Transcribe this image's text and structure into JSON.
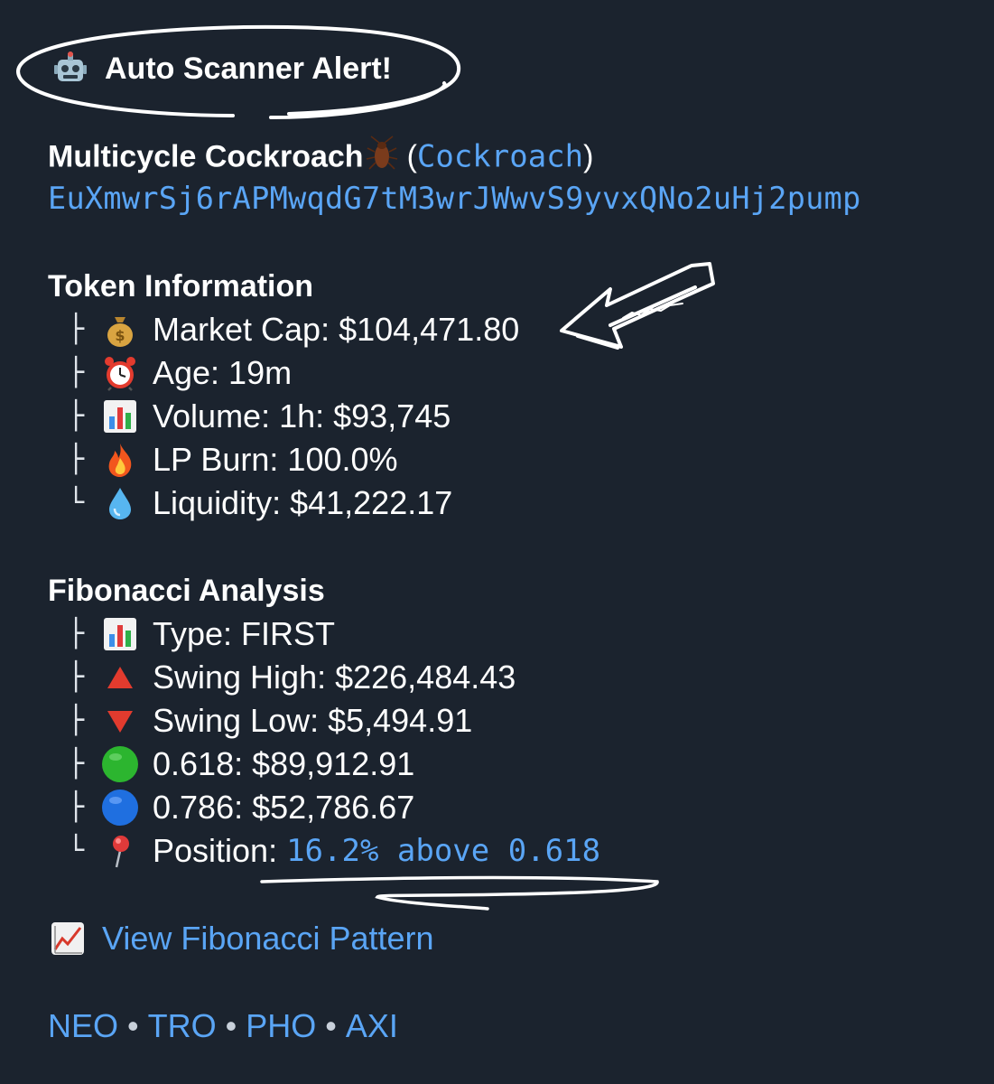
{
  "alert": {
    "title": "Auto Scanner Alert!",
    "icon": "robot-icon"
  },
  "token": {
    "name": "Multicycle Cockroach",
    "name_icon": "cockroach-icon",
    "paren_open": "(",
    "ticker": "Cockroach",
    "paren_close": ")",
    "address": "EuXmwrSj6rAPMwqdG7tM3wrJWwvS9yvxQNo2uHj2pump"
  },
  "token_info": {
    "heading": "Token Information",
    "items": [
      {
        "branch": "├",
        "icon": "money-bag-icon",
        "glyph": "💰",
        "text": "Market Cap: $104,471.80"
      },
      {
        "branch": "├",
        "icon": "alarm-clock-icon",
        "glyph": "⏰",
        "text": "Age: 19m"
      },
      {
        "branch": "├",
        "icon": "bar-chart-icon",
        "glyph": "📊",
        "text": "Volume: 1h: $93,745"
      },
      {
        "branch": "├",
        "icon": "fire-icon",
        "glyph": "🔥",
        "text": "LP Burn: 100.0%"
      },
      {
        "branch": "└",
        "icon": "droplet-icon",
        "glyph": "💧",
        "text": "Liquidity: $41,222.17"
      }
    ]
  },
  "fib": {
    "heading": "Fibonacci Analysis",
    "items": [
      {
        "branch": "├",
        "icon": "bar-chart-icon",
        "glyph": "📊",
        "text": "Type: FIRST"
      },
      {
        "branch": "├",
        "icon": "red-triangle-up-icon",
        "glyph": "▲",
        "text": "Swing High: $226,484.43"
      },
      {
        "branch": "├",
        "icon": "red-triangle-down-icon",
        "glyph": "▼",
        "text": "Swing Low: $5,494.91"
      },
      {
        "branch": "├",
        "icon": "green-circle-icon",
        "glyph": "",
        "text": "0.618: $89,912.91"
      },
      {
        "branch": "├",
        "icon": "blue-circle-icon",
        "glyph": "",
        "text": "0.786: $52,786.67"
      }
    ],
    "position": {
      "branch": "└",
      "icon": "round-pushpin-icon",
      "glyph": "📍",
      "label": "Position: ",
      "value": "16.2% above 0.618"
    }
  },
  "chart_link": {
    "icon": "chart-increasing-icon",
    "glyph": "📈",
    "label": "View Fibonacci Pattern"
  },
  "platforms": {
    "items": [
      "NEO",
      "TRO",
      "PHO",
      "AXI"
    ],
    "separator": "•"
  },
  "colors": {
    "background": "#1b232e",
    "text": "#ffffff",
    "link": "#5aa5f5",
    "annotation": "#ffffff"
  }
}
